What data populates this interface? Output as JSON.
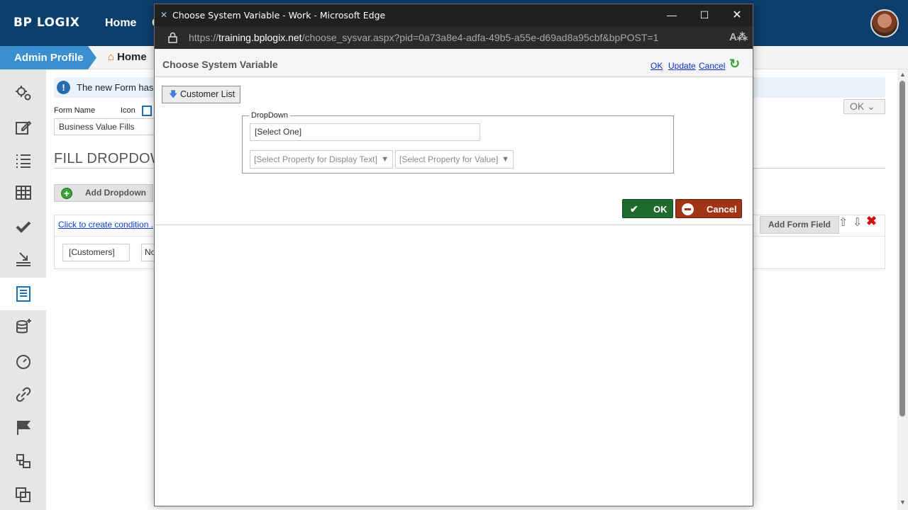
{
  "app": {
    "logo": "BP LOGIX",
    "nav_home": "Home",
    "nav_partial": "C"
  },
  "breadcrumb": {
    "admin_profile": "Admin Profile",
    "home": "Home"
  },
  "sidebar": {
    "items": [
      {
        "icon": "gears-icon"
      },
      {
        "icon": "edit-icon"
      },
      {
        "icon": "list-icon"
      },
      {
        "icon": "table-icon"
      },
      {
        "icon": "checkmark-icon"
      },
      {
        "icon": "download-icon"
      },
      {
        "icon": "form-icon",
        "active": true
      },
      {
        "icon": "database-add-icon"
      },
      {
        "icon": "timer-icon"
      },
      {
        "icon": "link-icon"
      },
      {
        "icon": "flag-icon"
      },
      {
        "icon": "hierarchy-icon"
      },
      {
        "icon": "copy-icon"
      }
    ]
  },
  "background": {
    "info_text": "The new Form has b",
    "ok_button": "OK",
    "form_name_label": "Form Name",
    "icon_label": "Icon",
    "form_name_value": "Business Value Fills",
    "heading": "FILL DROPDOW",
    "add_dropdown": "Add Dropdown",
    "condition_link": "Click to create condition .",
    "customers_value": "[Customers]",
    "no_value": "No",
    "add_form_field": "Add Form Field"
  },
  "popup": {
    "window_title": "Choose System Variable - Work - Microsoft Edge",
    "url_prefix": "https://",
    "url_host": "training.bplogix.net",
    "url_path": "/choose_sysvar.aspx?pid=0a73a8e4-adfa-49b5-a55e-d69ad8a95cbf&bpPOST=1",
    "header_title": "Choose System Variable",
    "link_ok": "OK",
    "link_update": "Update",
    "link_cancel": "Cancel",
    "customer_list_button": "Customer List",
    "legend": "DropDown",
    "select_value": "[Select One]",
    "display_text_prop": "[Select Property for Display Text]",
    "value_prop": "[Select Property for Value]",
    "ok_button": "OK",
    "cancel_button": "Cancel"
  },
  "colors": {
    "topbar": "#0c3e6b",
    "accent": "#3a8fd1",
    "ok_green": "#1f6b2e",
    "cancel_red": "#a23416"
  }
}
